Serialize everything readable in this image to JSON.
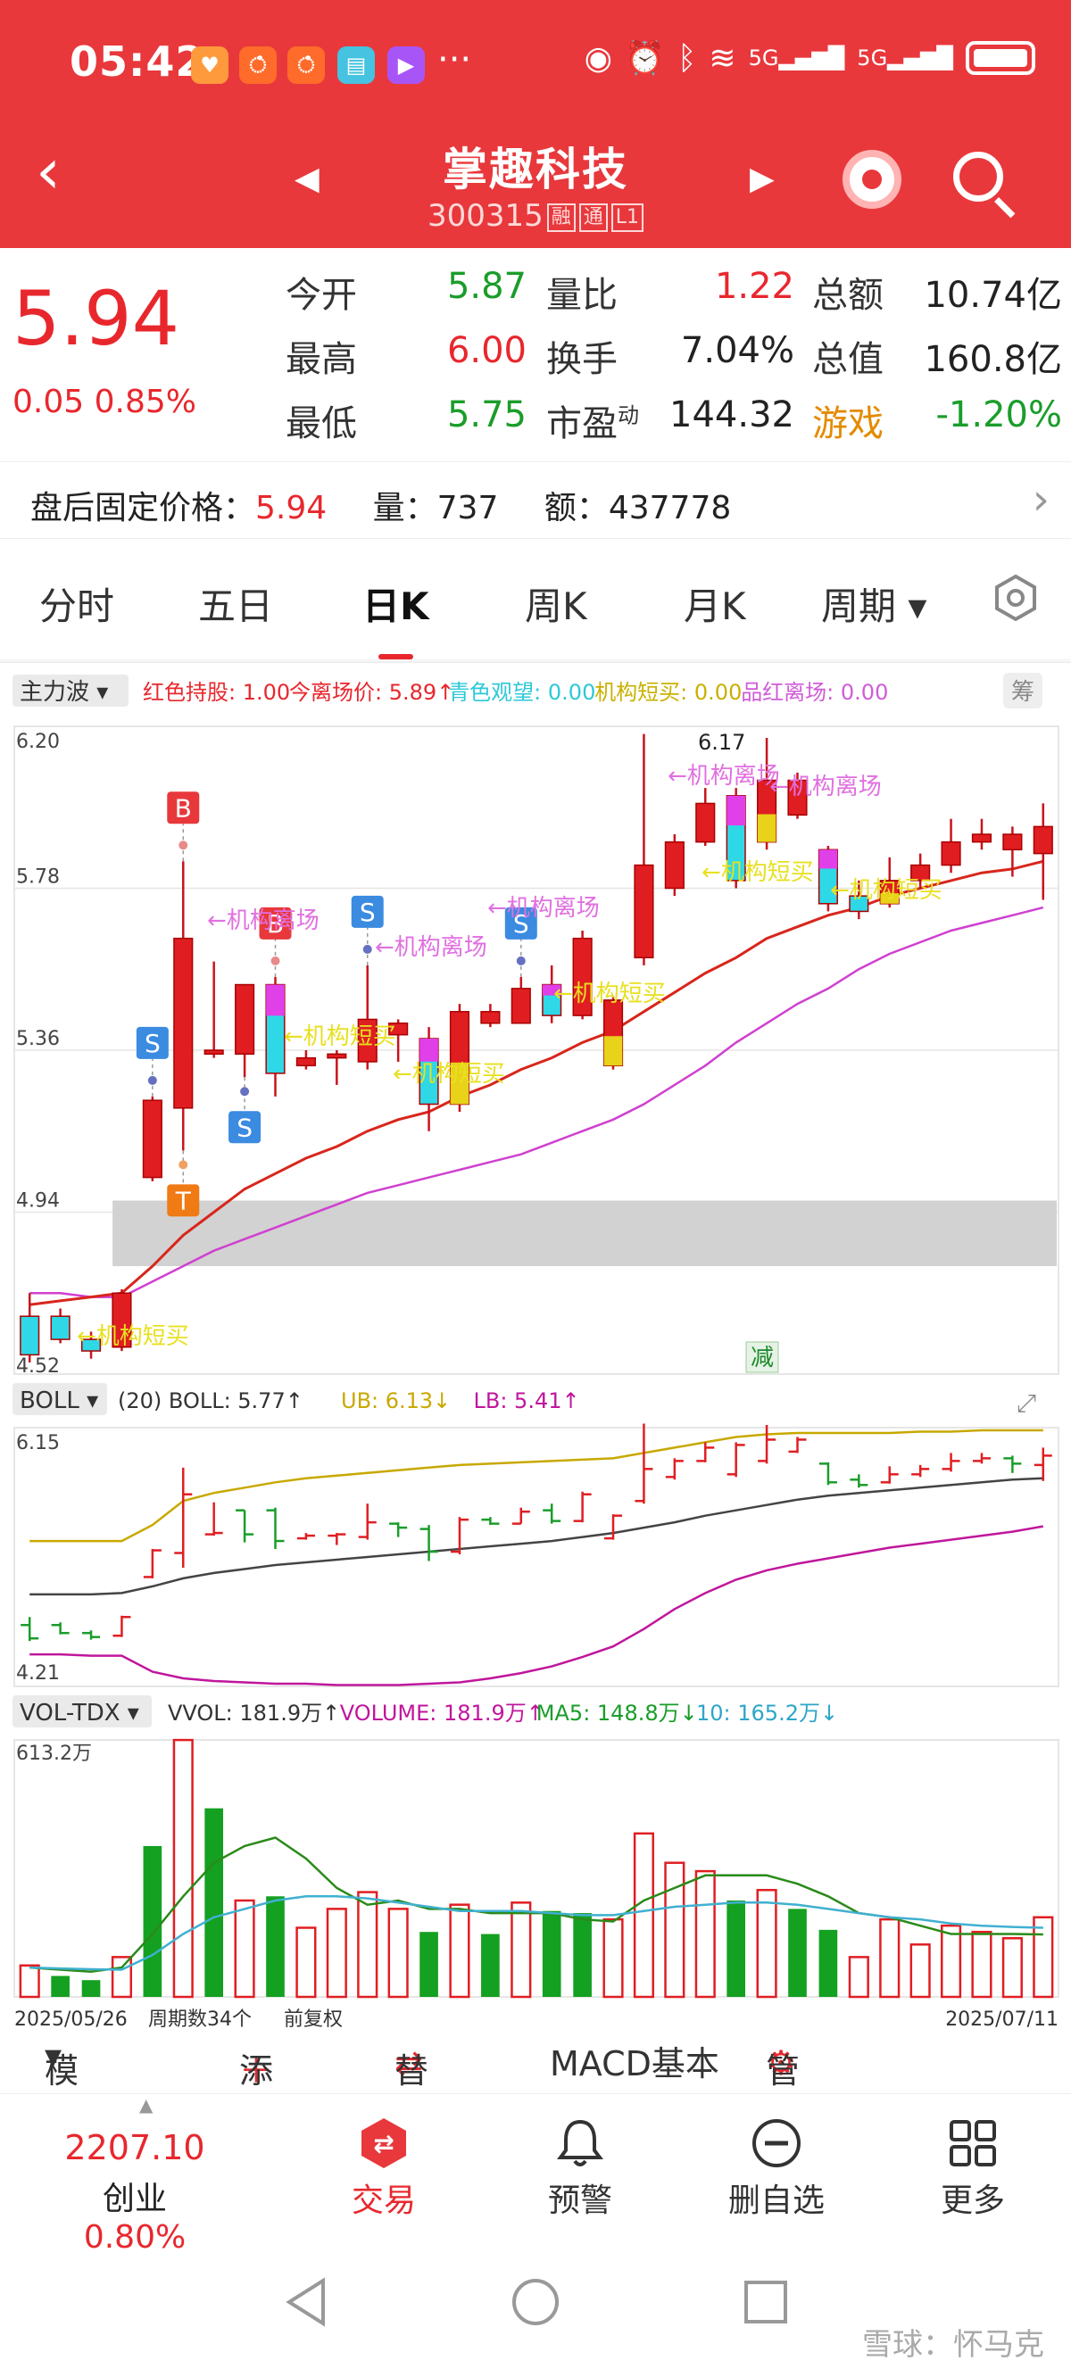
{
  "status": {
    "time": "05:42",
    "dots": "···",
    "net1": "5G",
    "net2": "5G"
  },
  "header": {
    "title": "掌趣科技",
    "code": "300315",
    "tags": [
      "融",
      "通",
      "L1"
    ]
  },
  "quote": {
    "price": "5.94",
    "change": "0.05",
    "change_pct": "0.85%",
    "rows": [
      [
        {
          "k": "今开",
          "v": "5.87",
          "c": "green"
        },
        {
          "k": "量比",
          "v": "1.22",
          "c": "red"
        },
        {
          "k": "总额",
          "v": "10.74亿",
          "c": "dark"
        }
      ],
      [
        {
          "k": "最高",
          "v": "6.00",
          "c": "red"
        },
        {
          "k": "换手",
          "v": "7.04%",
          "c": "dark"
        },
        {
          "k": "总值",
          "v": "160.8亿",
          "c": "dark"
        }
      ],
      [
        {
          "k": "最低",
          "v": "5.75",
          "c": "green"
        },
        {
          "k": "市盈",
          "sup": "动",
          "v": "144.32",
          "c": "dark"
        },
        {
          "k": "游戏",
          "v": "-1.20%",
          "c": "green",
          "korange": true
        }
      ]
    ]
  },
  "afterhours": {
    "label": "盘后固定价格：",
    "price": "5.94",
    "vol_label": "量：",
    "vol": "737",
    "amt_label": "额：",
    "amt": "437778"
  },
  "tabs": [
    "分时",
    "五日",
    "日K",
    "周K",
    "月K",
    "周期"
  ],
  "active_tab": 2,
  "indicator_main": {
    "name": "主力波",
    "items": [
      {
        "t": "红色持股: 1.00",
        "c": "#e8272d"
      },
      {
        "t": "今离场价: 5.89↑",
        "c": "#e8272d"
      },
      {
        "t": "青色观望: 0.00",
        "c": "#2ec8d8"
      },
      {
        "t": "机构短买: 0.00",
        "c": "#c9b000"
      },
      {
        "t": "品红离场: 0.00",
        "c": "#d05cd8"
      }
    ],
    "badge": "筹"
  },
  "axis_main": {
    "ticks": [
      "6.20",
      "5.78",
      "5.36",
      "4.94",
      "4.52"
    ],
    "peak": "6.17",
    "minus": "减"
  },
  "annotations": {
    "out": "←机构离场",
    "buy": "←机构短买",
    "buy_dup": "机构短买"
  },
  "markers": {
    "S": "S",
    "B": "B",
    "T": "T"
  },
  "indicator_boll": {
    "name": "BOLL",
    "items": [
      {
        "t": "(20) BOLL: 5.77↑",
        "c": "#333"
      },
      {
        "t": "UB: 6.13↓",
        "c": "#c9a800"
      },
      {
        "t": "LB: 5.41↑",
        "c": "#c0169c"
      }
    ],
    "ticks": [
      "6.15",
      "4.21"
    ]
  },
  "indicator_vol": {
    "name": "VOL-TDX",
    "items": [
      {
        "t": "VVOL: 181.9万↑",
        "c": "#333"
      },
      {
        "t": "VOLUME: 181.9万↑",
        "c": "#c0169c"
      },
      {
        "t": "MA5: 148.8万↓",
        "c": "#1a9d2a"
      },
      {
        "t": "10: 165.2万↓",
        "c": "#2ea6c8"
      }
    ],
    "max": "613.2万"
  },
  "footer_axis": {
    "start": "2025/05/26",
    "count": "周期数34个",
    "adj": "前复权",
    "end": "2025/07/11"
  },
  "menubar": {
    "template": "模板",
    "add": "添加",
    "replace": "替换",
    "macd": "MACD基本",
    "manage": "管理"
  },
  "bottom_nav": {
    "index_value": "2207.10",
    "index_name": "创业",
    "index_pct": "0.80%",
    "trade": "交易",
    "alert": "预警",
    "remove": "删自选",
    "more": "更多"
  },
  "watermark": "雪球：怀马克",
  "chart_data": {
    "type": "candlestick",
    "ylim": [
      4.52,
      6.2
    ],
    "bars": [
      {
        "o": 4.67,
        "h": 4.73,
        "l": 4.55,
        "c": 4.57,
        "col": "cyan"
      },
      {
        "o": 4.67,
        "h": 4.69,
        "l": 4.6,
        "c": 4.61,
        "col": "cyan"
      },
      {
        "o": 4.61,
        "h": 4.63,
        "l": 4.56,
        "c": 4.58,
        "col": "cyan"
      },
      {
        "o": 4.59,
        "h": 4.74,
        "l": 4.58,
        "c": 4.73,
        "col": "red"
      },
      {
        "o": 5.03,
        "h": 5.24,
        "l": 5.02,
        "c": 5.23,
        "col": "red"
      },
      {
        "o": 5.21,
        "h": 5.85,
        "l": 5.1,
        "c": 5.65,
        "col": "red"
      },
      {
        "o": 5.35,
        "h": 5.59,
        "l": 5.34,
        "c": 5.36,
        "col": "red"
      },
      {
        "o": 5.53,
        "h": 5.53,
        "l": 5.29,
        "c": 5.35,
        "col": "red"
      },
      {
        "o": 5.53,
        "h": 5.55,
        "l": 5.24,
        "c": 5.3,
        "col": "cyanmag"
      },
      {
        "o": 5.32,
        "h": 5.36,
        "l": 5.31,
        "c": 5.34,
        "col": "red"
      },
      {
        "o": 5.34,
        "h": 5.36,
        "l": 5.27,
        "c": 5.35,
        "col": "red"
      },
      {
        "o": 5.33,
        "h": 5.58,
        "l": 5.31,
        "c": 5.44,
        "col": "red"
      },
      {
        "o": 5.43,
        "h": 5.44,
        "l": 5.33,
        "c": 5.4,
        "col": "red"
      },
      {
        "o": 5.39,
        "h": 5.42,
        "l": 5.15,
        "c": 5.22,
        "col": "cyanmag"
      },
      {
        "o": 5.22,
        "h": 5.48,
        "l": 5.2,
        "c": 5.46,
        "col": "yellowred"
      },
      {
        "o": 5.46,
        "h": 5.48,
        "l": 5.42,
        "c": 5.43,
        "col": "red"
      },
      {
        "o": 5.43,
        "h": 5.55,
        "l": 5.43,
        "c": 5.52,
        "col": "red"
      },
      {
        "o": 5.53,
        "h": 5.58,
        "l": 5.43,
        "c": 5.45,
        "col": "cyanmag"
      },
      {
        "o": 5.45,
        "h": 5.67,
        "l": 5.44,
        "c": 5.65,
        "col": "red"
      },
      {
        "o": 5.32,
        "h": 5.5,
        "l": 5.31,
        "c": 5.49,
        "col": "yellowred"
      },
      {
        "o": 5.6,
        "h": 6.18,
        "l": 5.58,
        "c": 5.84,
        "col": "red"
      },
      {
        "o": 5.78,
        "h": 5.92,
        "l": 5.76,
        "c": 5.9,
        "col": "red"
      },
      {
        "o": 5.9,
        "h": 6.04,
        "l": 5.89,
        "c": 6.0,
        "col": "red"
      },
      {
        "o": 5.8,
        "h": 6.04,
        "l": 5.78,
        "c": 6.02,
        "col": "cyanmag"
      },
      {
        "o": 5.9,
        "h": 6.17,
        "l": 5.88,
        "c": 6.06,
        "col": "yellowred"
      },
      {
        "o": 5.97,
        "h": 6.08,
        "l": 5.96,
        "c": 6.06,
        "col": "red"
      },
      {
        "o": 5.88,
        "h": 5.89,
        "l": 5.72,
        "c": 5.74,
        "col": "cyanmag"
      },
      {
        "o": 5.76,
        "h": 5.8,
        "l": 5.7,
        "c": 5.72,
        "col": "cyan"
      },
      {
        "o": 5.74,
        "h": 5.86,
        "l": 5.73,
        "c": 5.8,
        "col": "yellowred"
      },
      {
        "o": 5.8,
        "h": 5.87,
        "l": 5.78,
        "c": 5.84,
        "col": "red"
      },
      {
        "o": 5.84,
        "h": 5.96,
        "l": 5.82,
        "c": 5.9,
        "col": "red"
      },
      {
        "o": 5.9,
        "h": 5.96,
        "l": 5.88,
        "c": 5.92,
        "col": "red"
      },
      {
        "o": 5.92,
        "h": 5.94,
        "l": 5.81,
        "c": 5.88,
        "col": "red"
      },
      {
        "o": 5.87,
        "h": 6.0,
        "l": 5.75,
        "c": 5.94,
        "col": "red"
      }
    ],
    "ma_red": [
      4.7,
      4.71,
      4.72,
      4.73,
      4.8,
      4.88,
      4.94,
      5.0,
      5.04,
      5.08,
      5.11,
      5.15,
      5.18,
      5.2,
      5.24,
      5.27,
      5.31,
      5.34,
      5.38,
      5.41,
      5.46,
      5.51,
      5.56,
      5.6,
      5.65,
      5.68,
      5.71,
      5.73,
      5.76,
      5.78,
      5.8,
      5.82,
      5.83,
      5.85
    ],
    "ma_mag": [
      4.73,
      4.73,
      4.72,
      4.72,
      4.76,
      4.8,
      4.84,
      4.87,
      4.9,
      4.93,
      4.96,
      4.99,
      5.01,
      5.03,
      5.05,
      5.07,
      5.09,
      5.12,
      5.15,
      5.18,
      5.22,
      5.27,
      5.32,
      5.38,
      5.43,
      5.48,
      5.52,
      5.57,
      5.61,
      5.64,
      5.67,
      5.69,
      5.71,
      5.73
    ],
    "boll_ub": [
      5.3,
      5.3,
      5.3,
      5.3,
      5.42,
      5.6,
      5.66,
      5.7,
      5.74,
      5.77,
      5.79,
      5.81,
      5.83,
      5.85,
      5.87,
      5.88,
      5.89,
      5.9,
      5.91,
      5.92,
      5.96,
      6.0,
      6.04,
      6.08,
      6.1,
      6.11,
      6.11,
      6.11,
      6.11,
      6.12,
      6.12,
      6.13,
      6.13,
      6.13
    ],
    "boll_mid": [
      4.9,
      4.9,
      4.9,
      4.91,
      4.96,
      5.02,
      5.06,
      5.09,
      5.12,
      5.14,
      5.16,
      5.18,
      5.2,
      5.22,
      5.24,
      5.26,
      5.28,
      5.3,
      5.33,
      5.36,
      5.4,
      5.44,
      5.49,
      5.53,
      5.57,
      5.61,
      5.64,
      5.66,
      5.68,
      5.7,
      5.72,
      5.74,
      5.76,
      5.77
    ],
    "boll_lb": [
      4.45,
      4.45,
      4.44,
      4.44,
      4.32,
      4.27,
      4.25,
      4.24,
      4.23,
      4.23,
      4.22,
      4.22,
      4.22,
      4.23,
      4.24,
      4.27,
      4.31,
      4.36,
      4.43,
      4.51,
      4.64,
      4.79,
      4.91,
      5.01,
      5.08,
      5.13,
      5.17,
      5.21,
      5.25,
      5.28,
      5.31,
      5.34,
      5.37,
      5.41
    ],
    "volume": [
      {
        "v": 75,
        "g": false
      },
      {
        "v": 50,
        "g": true
      },
      {
        "v": 40,
        "g": true
      },
      {
        "v": 95,
        "g": false
      },
      {
        "v": 360,
        "g": true
      },
      {
        "v": 613,
        "g": false
      },
      {
        "v": 450,
        "g": true
      },
      {
        "v": 230,
        "g": false
      },
      {
        "v": 240,
        "g": true
      },
      {
        "v": 165,
        "g": false
      },
      {
        "v": 210,
        "g": false
      },
      {
        "v": 250,
        "g": false
      },
      {
        "v": 210,
        "g": false
      },
      {
        "v": 155,
        "g": true
      },
      {
        "v": 220,
        "g": false
      },
      {
        "v": 150,
        "g": true
      },
      {
        "v": 225,
        "g": false
      },
      {
        "v": 205,
        "g": true
      },
      {
        "v": 200,
        "g": true
      },
      {
        "v": 185,
        "g": false
      },
      {
        "v": 390,
        "g": false
      },
      {
        "v": 320,
        "g": false
      },
      {
        "v": 300,
        "g": false
      },
      {
        "v": 230,
        "g": true
      },
      {
        "v": 255,
        "g": false
      },
      {
        "v": 210,
        "g": true
      },
      {
        "v": 160,
        "g": true
      },
      {
        "v": 95,
        "g": false
      },
      {
        "v": 185,
        "g": false
      },
      {
        "v": 125,
        "g": false
      },
      {
        "v": 170,
        "g": false
      },
      {
        "v": 155,
        "g": false
      },
      {
        "v": 140,
        "g": false
      },
      {
        "v": 190,
        "g": false
      }
    ],
    "vol_ma5": [
      70,
      65,
      60,
      70,
      150,
      240,
      320,
      360,
      380,
      330,
      260,
      220,
      230,
      210,
      210,
      200,
      200,
      200,
      185,
      180,
      230,
      260,
      290,
      290,
      290,
      270,
      240,
      200,
      190,
      170,
      150,
      150,
      150,
      149
    ],
    "vol_ma10": [
      70,
      68,
      66,
      65,
      100,
      150,
      190,
      210,
      230,
      240,
      240,
      235,
      225,
      215,
      205,
      205,
      205,
      200,
      195,
      195,
      205,
      215,
      220,
      225,
      225,
      220,
      210,
      200,
      190,
      185,
      175,
      170,
      167,
      165
    ]
  }
}
